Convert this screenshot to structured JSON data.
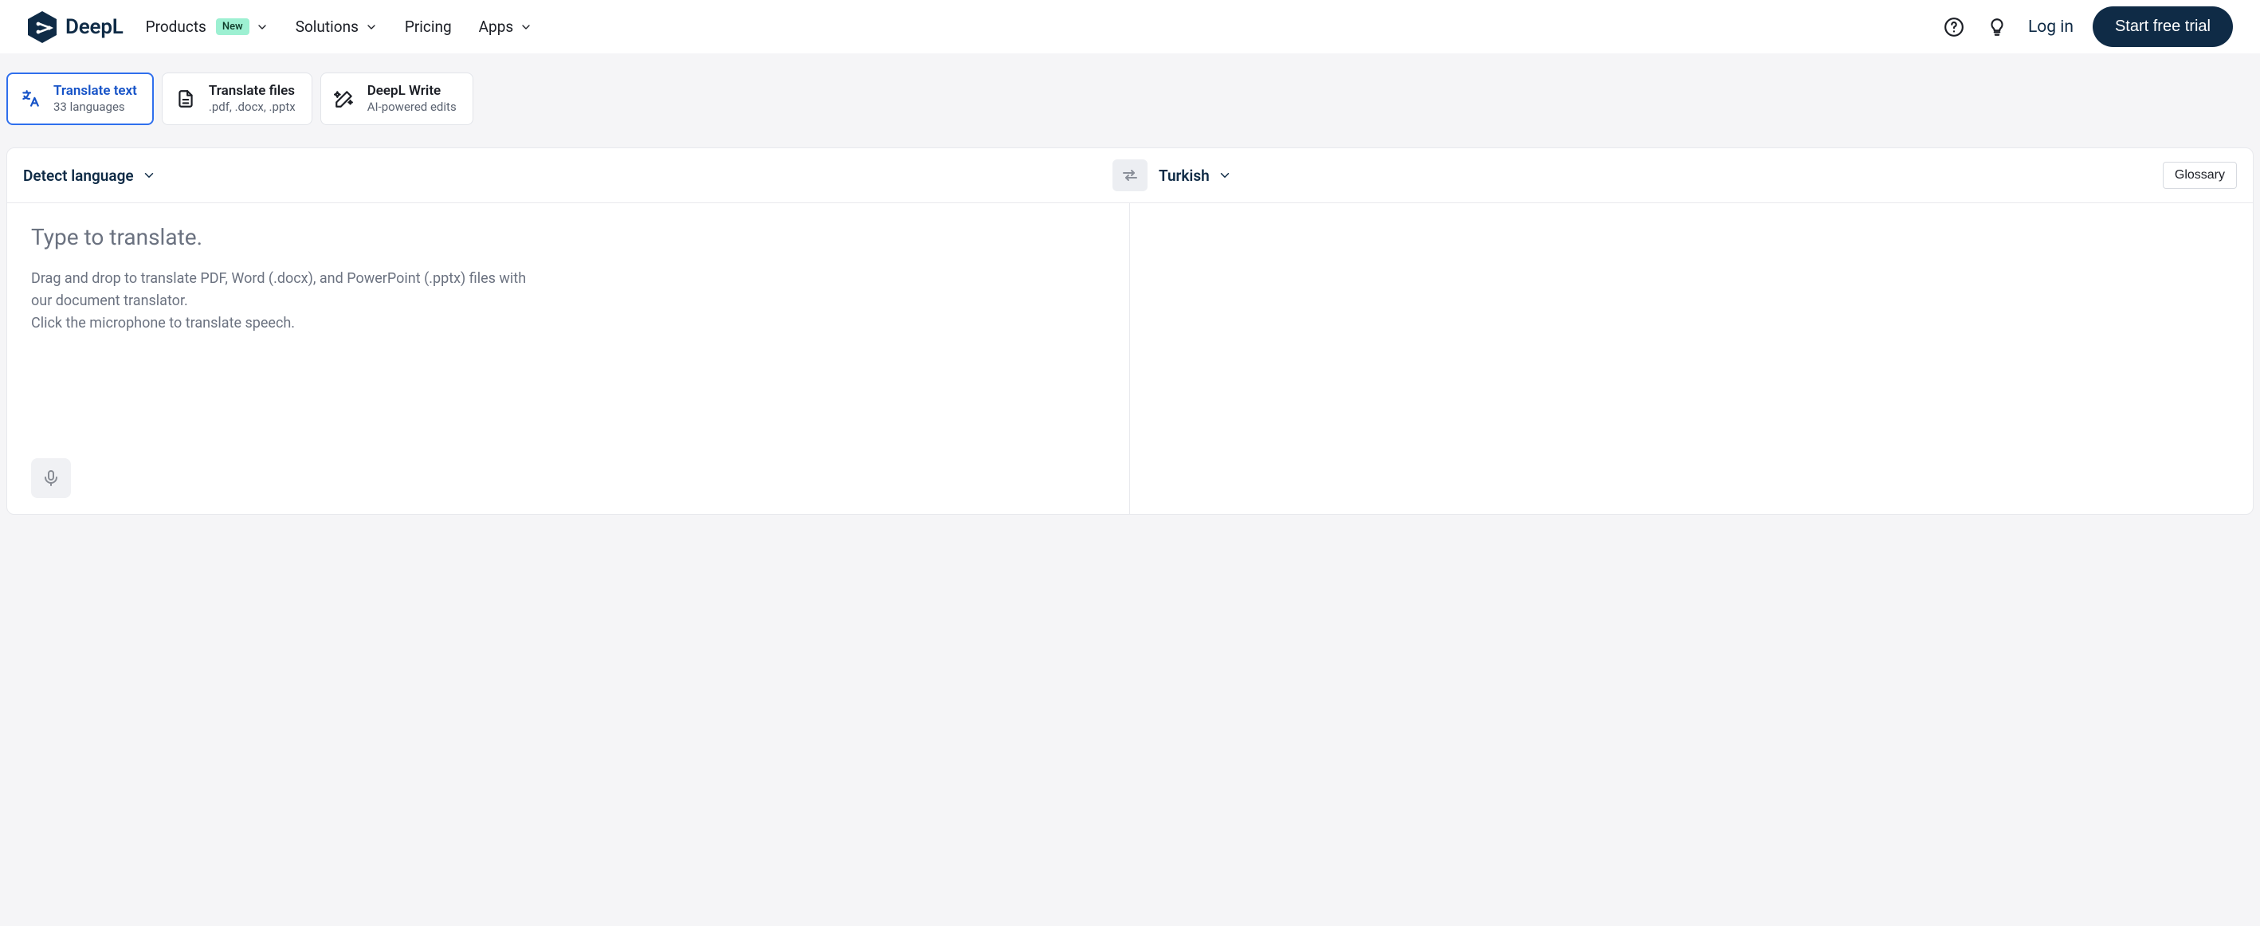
{
  "brand": {
    "name": "DeepL"
  },
  "nav": {
    "products": {
      "label": "Products",
      "badge": "New"
    },
    "solutions": {
      "label": "Solutions"
    },
    "pricing": {
      "label": "Pricing"
    },
    "apps": {
      "label": "Apps"
    }
  },
  "header": {
    "login": "Log in",
    "cta": "Start free trial"
  },
  "modes": {
    "text": {
      "title": "Translate text",
      "sub": "33 languages"
    },
    "files": {
      "title": "Translate files",
      "sub": ".pdf, .docx, .pptx"
    },
    "write": {
      "title": "DeepL Write",
      "sub": "AI-powered edits"
    }
  },
  "translator": {
    "source_lang": "Detect language",
    "target_lang": "Turkish",
    "glossary": "Glossary",
    "placeholder": "Type to translate.",
    "hint_line1": "Drag and drop to translate PDF, Word (.docx), and PowerPoint (.pptx) files with our document translator.",
    "hint_line2": "Click the microphone to translate speech."
  }
}
